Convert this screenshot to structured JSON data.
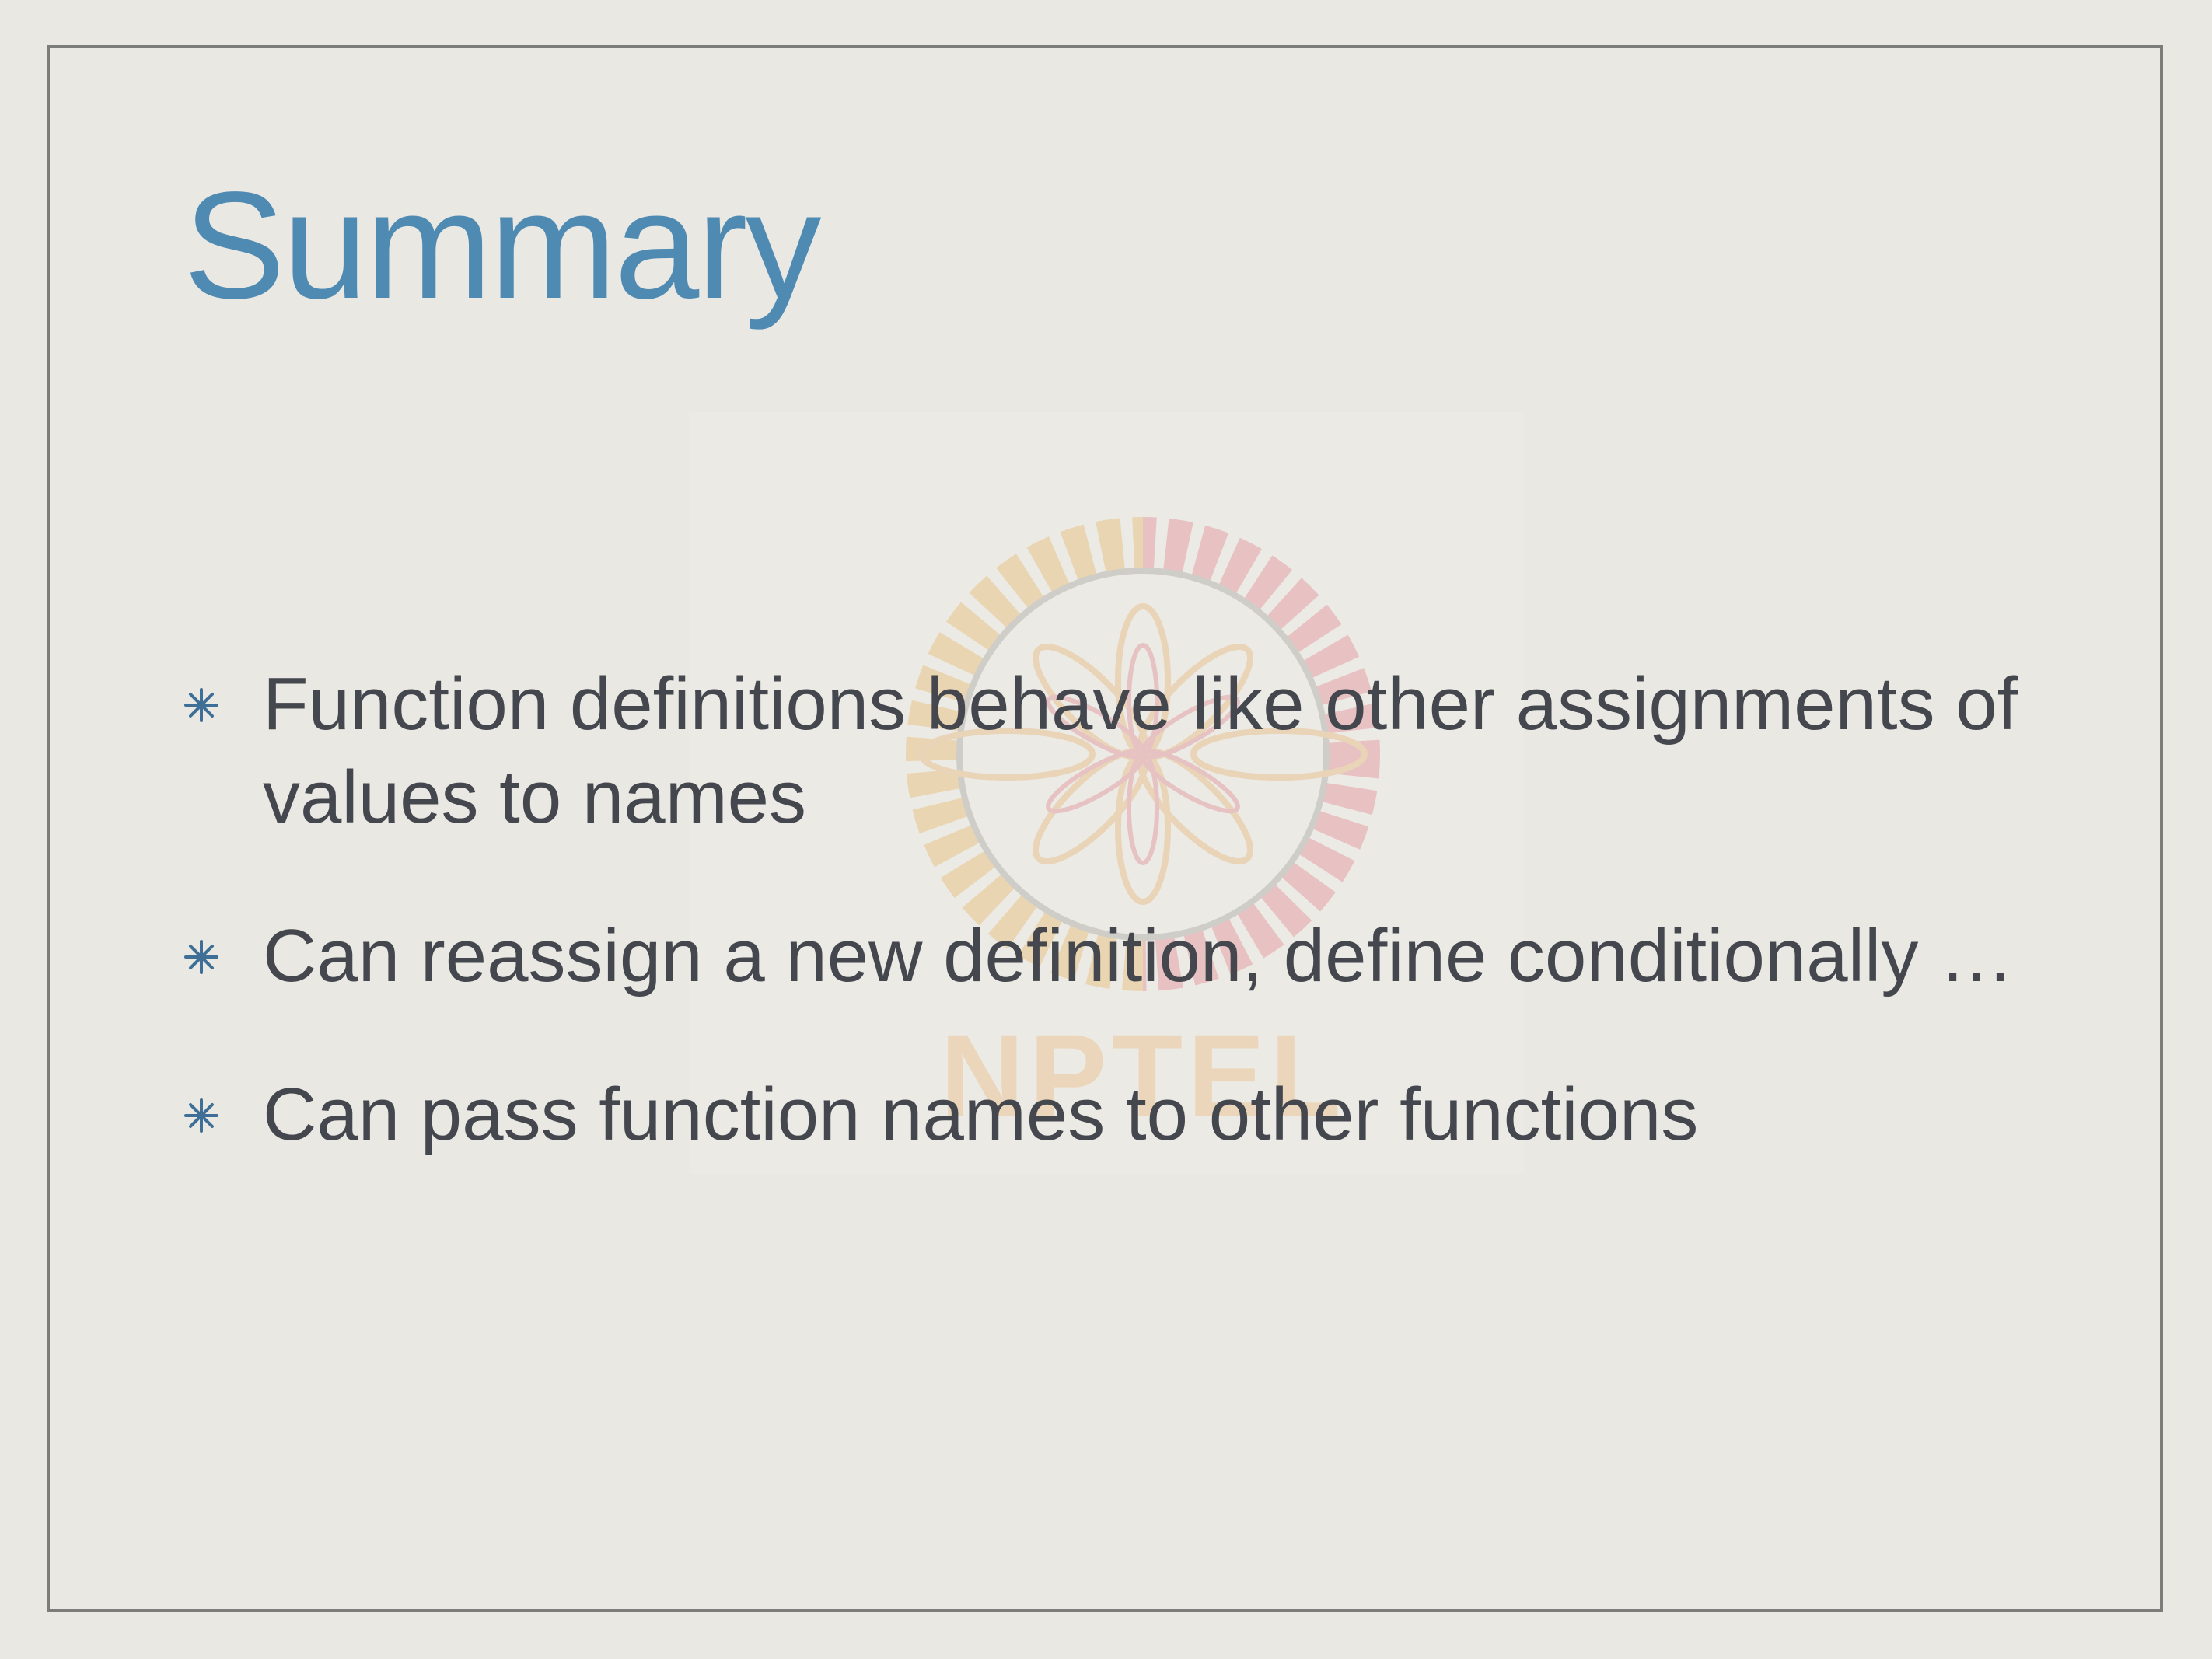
{
  "slide": {
    "title": "Summary",
    "watermark_text": "NPTEL",
    "bullet_icon": "asterisk-bullet-icon",
    "colors": {
      "title": "#4f8ab3",
      "text": "#45474e",
      "background": "#e9e8e3",
      "frame": "#7c7c7a",
      "bullet": "#3f6f96"
    },
    "bullets": [
      {
        "text": "Function definitions behave like other assignments of values to names"
      },
      {
        "text": "Can reassign a new definition, define conditionally …"
      },
      {
        "text": "Can pass function names to other functions"
      }
    ]
  }
}
